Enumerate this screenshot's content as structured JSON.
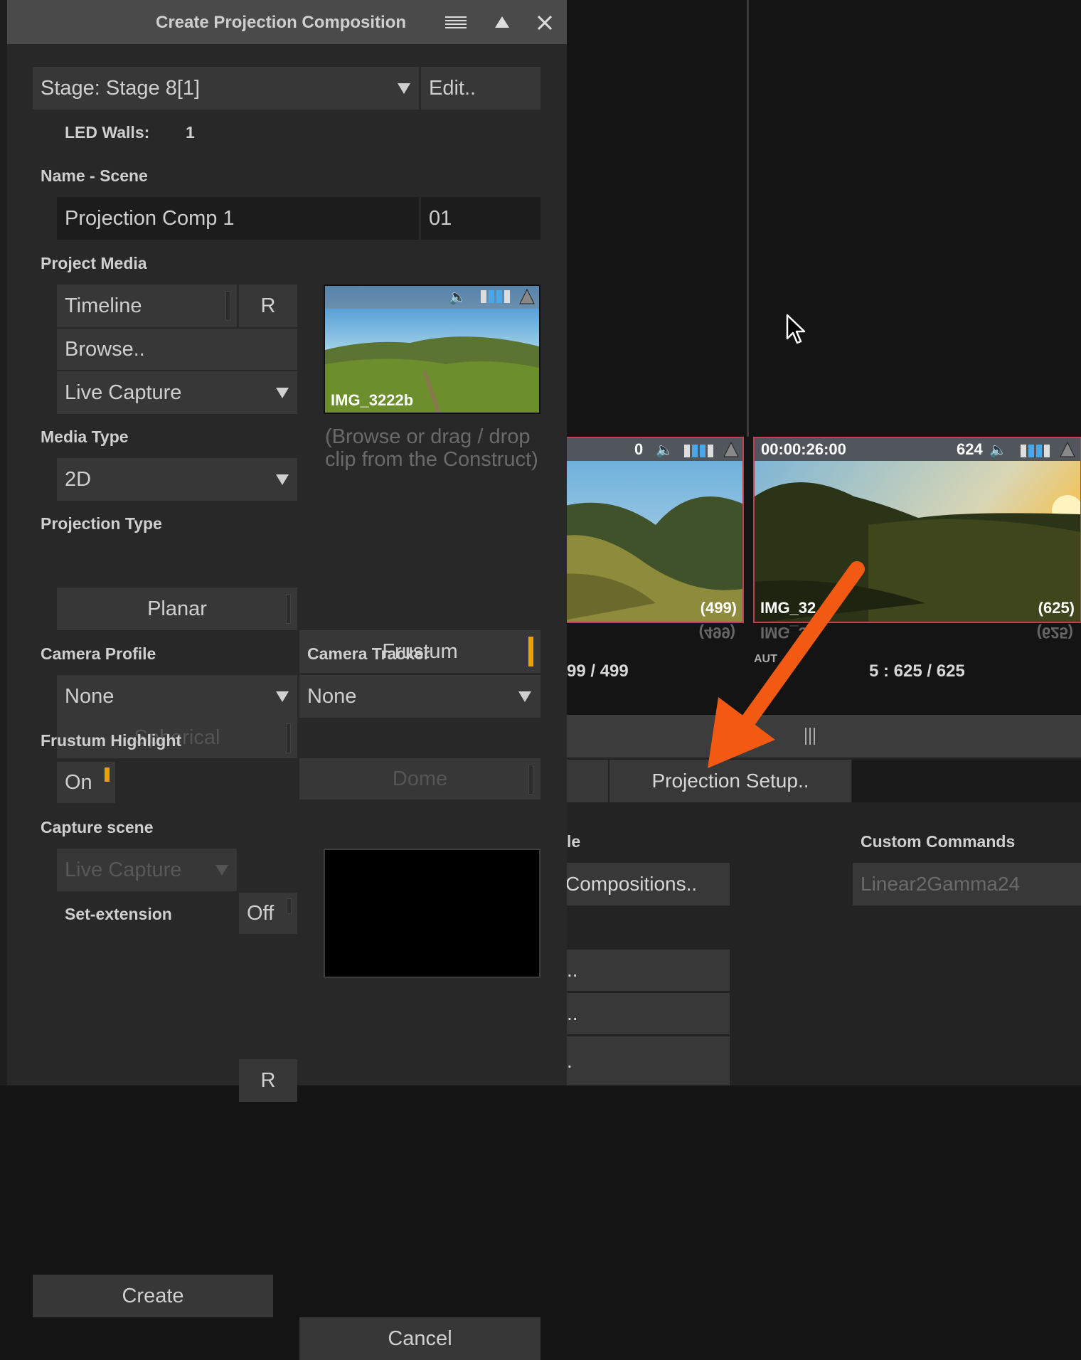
{
  "dialog": {
    "title": "Create Projection Composition",
    "stage": {
      "value": "Stage: Stage 8[1]",
      "edit_label": "Edit.."
    },
    "led_walls": {
      "label": "LED Walls:",
      "value": "1"
    },
    "name_scene": {
      "label": "Name - Scene",
      "name_value": "Projection Comp 1",
      "scene_value": "01"
    },
    "project_media": {
      "label": "Project Media",
      "timeline_label": "Timeline",
      "r_label": "R",
      "browse_label": "Browse..",
      "live_capture_label": "Live Capture",
      "preview_clip_name": "IMG_3222b",
      "hint": "(Browse or drag / drop clip from the Construct)"
    },
    "media_type": {
      "label": "Media Type",
      "value": "2D"
    },
    "projection_type": {
      "label": "Projection Type",
      "options": [
        "Planar",
        "Frustum",
        "Spherical",
        "Dome"
      ],
      "selected": "Frustum"
    },
    "camera_profile": {
      "label": "Camera Profile",
      "value": "None"
    },
    "camera_tracker": {
      "label": "Camera Tracker",
      "value": "None"
    },
    "frustum_highlight": {
      "label": "Frustum Highlight",
      "value": "On"
    },
    "capture_scene": {
      "label": "Capture scene",
      "live_capture_label": "Live Capture",
      "r_label": "R",
      "set_extension_label": "Set-extension",
      "set_extension_value": "Off"
    },
    "create_label": "Create",
    "cancel_label": "Cancel"
  },
  "background": {
    "clip1": {
      "frame_number": "0",
      "count": "(499)",
      "counter": "99 / 499"
    },
    "clip2": {
      "timecode": "00:00:26:00",
      "frame_number": "624",
      "name": "IMG_32",
      "count": "(625)",
      "counter": "5 : 625 / 625",
      "auto_label": "AUT"
    },
    "projection_setup_label": "Projection Setup..",
    "section_fragment": "le",
    "compositions_label": "Compositions..",
    "custom_commands": {
      "label": "Custom Commands",
      "value": "Linear2Gamma24"
    },
    "list_items": [
      "..",
      "..",
      "."
    ]
  },
  "colors": {
    "accent_indicator": "#f0a000",
    "annotation_arrow": "#f25a14",
    "thumb_border": "#c04050"
  }
}
